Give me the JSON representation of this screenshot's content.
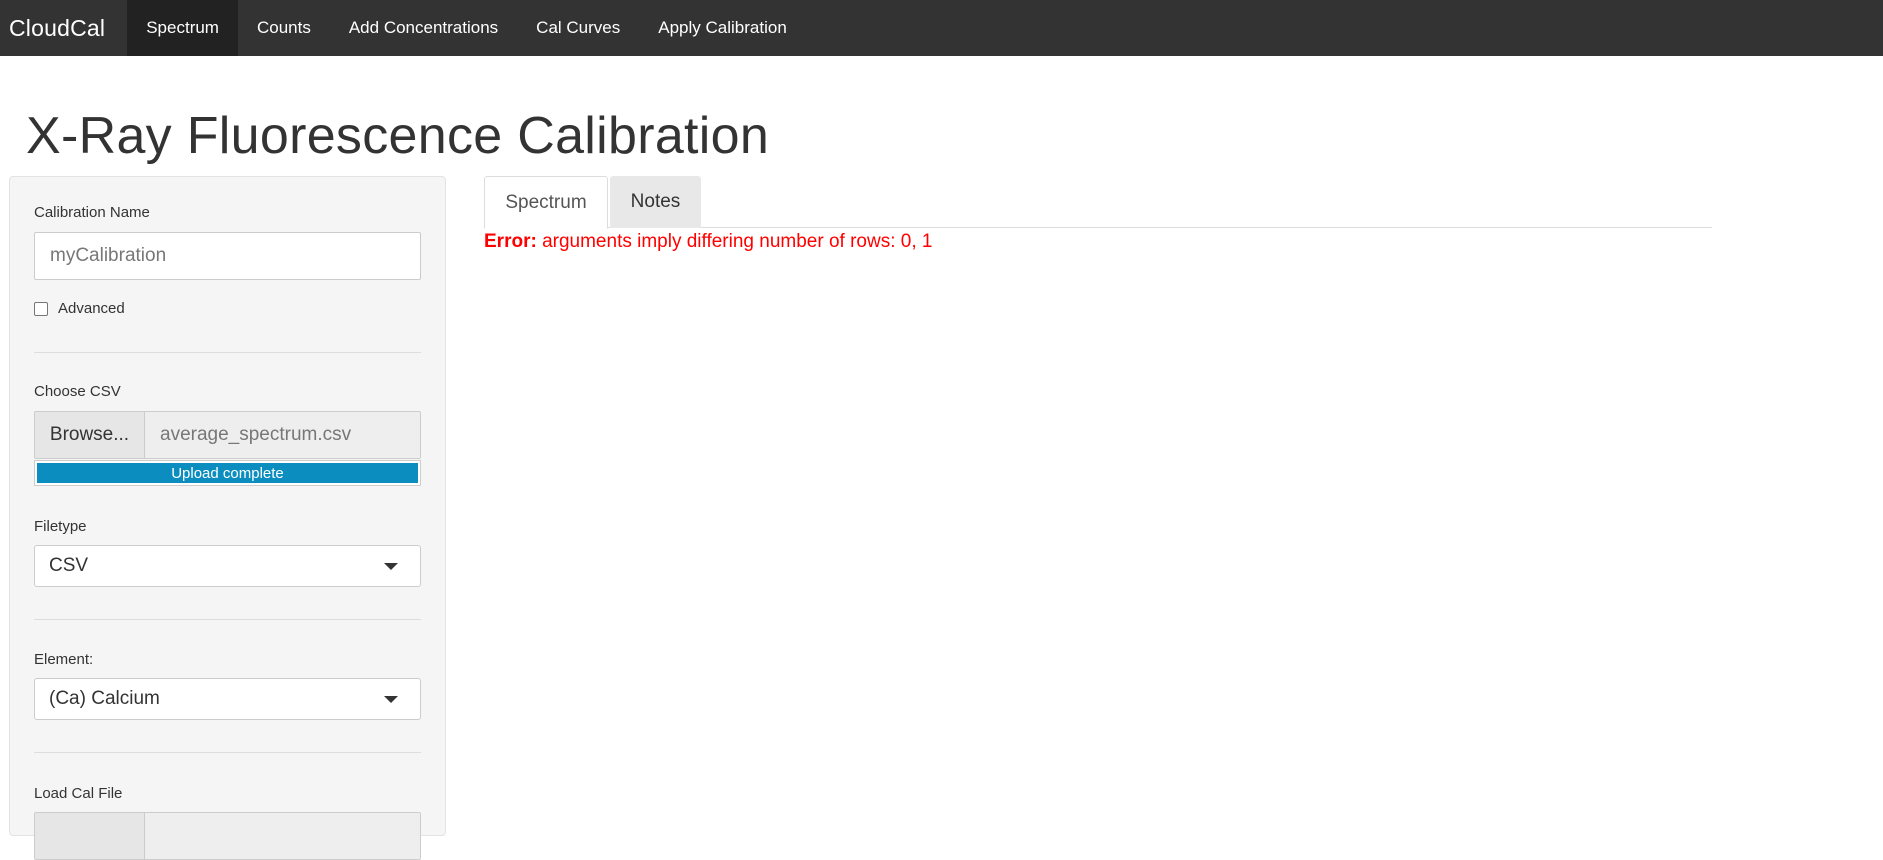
{
  "navbar": {
    "brand": "CloudCal",
    "items": [
      {
        "label": "Spectrum",
        "active": true
      },
      {
        "label": "Counts",
        "active": false
      },
      {
        "label": "Add Concentrations",
        "active": false
      },
      {
        "label": "Cal Curves",
        "active": false
      },
      {
        "label": "Apply Calibration",
        "active": false
      }
    ]
  },
  "page": {
    "title": "X-Ray Fluorescence Calibration"
  },
  "sidebar": {
    "calibration_name_label": "Calibration Name",
    "calibration_name_value": "myCalibration",
    "advanced_label": "Advanced",
    "advanced_checked": false,
    "choose_csv_label": "Choose CSV",
    "browse_label": "Browse...",
    "csv_file_name": "average_spectrum.csv",
    "upload_status": "Upload complete",
    "upload_progress": 1.0,
    "filetype_label": "Filetype",
    "filetype_value": "CSV",
    "element_label": "Element:",
    "element_value": "(Ca) Calcium",
    "load_cal_label": "Load Cal File"
  },
  "tabs": [
    {
      "label": "Spectrum",
      "active": true
    },
    {
      "label": "Notes",
      "active": false
    }
  ],
  "error": {
    "prefix": "Error:",
    "message": "arguments imply differing number of rows: 0, 1"
  },
  "colors": {
    "navbar_bg": "#333333",
    "navbar_active_bg": "#222222",
    "progress_bar": "#0b8ebf",
    "error_text": "#ff0000"
  },
  "icons": {
    "select_caret": "caret-down-icon"
  }
}
